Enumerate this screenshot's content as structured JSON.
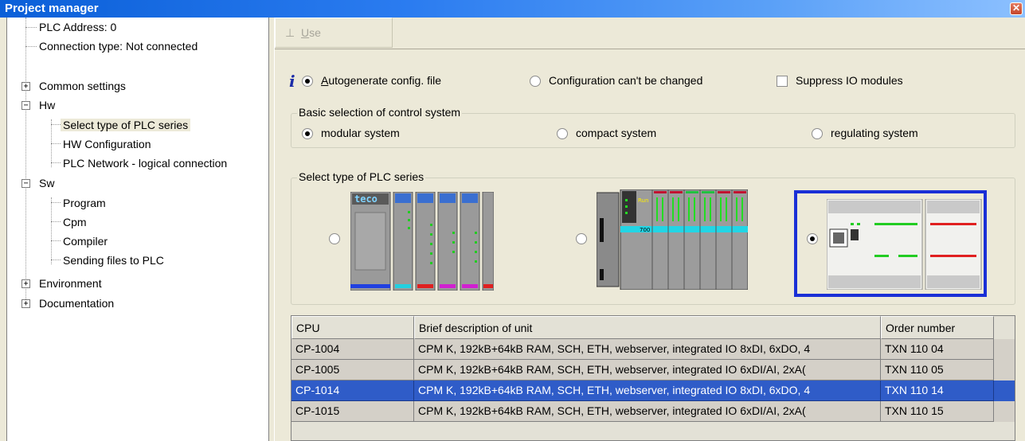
{
  "window": {
    "title": "Project manager",
    "close_glyph": "✕"
  },
  "tree": {
    "items": [
      {
        "label": "PLC Address: 0"
      },
      {
        "label": "Connection type: Not connected"
      },
      {
        "label": "Common settings",
        "expander": "+"
      },
      {
        "label": "Hw",
        "expander": "−"
      },
      {
        "label": "Select type of PLC series"
      },
      {
        "label": "HW Configuration"
      },
      {
        "label": "PLC Network - logical connection"
      },
      {
        "label": "Sw",
        "expander": "−"
      },
      {
        "label": "Program"
      },
      {
        "label": "Cpm"
      },
      {
        "label": "Compiler"
      },
      {
        "label": "Sending files to PLC"
      },
      {
        "label": "Environment",
        "expander": "+"
      },
      {
        "label": "Documentation",
        "expander": "+"
      }
    ]
  },
  "toolbar": {
    "use_label": "Use",
    "use_label_first": "U",
    "use_label_rest": "se"
  },
  "options": {
    "autogen": {
      "label_first": "A",
      "label_rest": "utogenerate config. file",
      "checked": true
    },
    "locked": {
      "label": "Configuration can't be changed",
      "checked": false
    },
    "suppress": {
      "label": "Suppress IO modules",
      "checked": false
    }
  },
  "basic_selection": {
    "title": "Basic selection of control system",
    "modular": {
      "label": "modular system",
      "checked": true
    },
    "compact": {
      "label": "compact system",
      "checked": false
    },
    "regulating": {
      "label": "regulating system",
      "checked": false
    }
  },
  "plc_series": {
    "title": "Select type of PLC series",
    "options": [
      {
        "name": "tecomat-foxtrot-modular",
        "logo_text": "teco",
        "checked": false
      },
      {
        "name": "tecomat-700-series",
        "module_text": "700",
        "run_text": "Run",
        "checked": false
      },
      {
        "name": "cp-10xx-compact",
        "checked": true
      }
    ]
  },
  "table": {
    "columns": [
      "CPU",
      "Brief description of unit",
      "Order number"
    ],
    "rows": [
      {
        "cpu": "CP-1004",
        "desc": "CPM K, 192kB+64kB RAM, SCH, ETH, webserver, integrated IO 8xDI, 6xDO, 4",
        "order": "TXN 110 04",
        "selected": false
      },
      {
        "cpu": "CP-1005",
        "desc": "CPM K, 192kB+64kB RAM, SCH, ETH, webserver, integrated IO 6xDI/AI, 2xA(",
        "order": "TXN 110 05",
        "selected": false
      },
      {
        "cpu": "CP-1014",
        "desc": "CPM K, 192kB+64kB RAM, SCH, ETH, webserver, integrated IO 8xDI, 6xDO, 4",
        "order": "TXN 110 14",
        "selected": true
      },
      {
        "cpu": "CP-1015",
        "desc": "CPM K, 192kB+64kB RAM, SCH, ETH, webserver, integrated IO 6xDI/AI, 2xA(",
        "order": "TXN 110 15",
        "selected": false
      }
    ]
  },
  "colors": {
    "title_bar": "#0a5fd8",
    "selection": "#2f5cc8",
    "frame_highlight": "#1a2fd6"
  },
  "icons": {
    "info": "info-icon",
    "use": "use-icon",
    "close": "close-icon"
  }
}
